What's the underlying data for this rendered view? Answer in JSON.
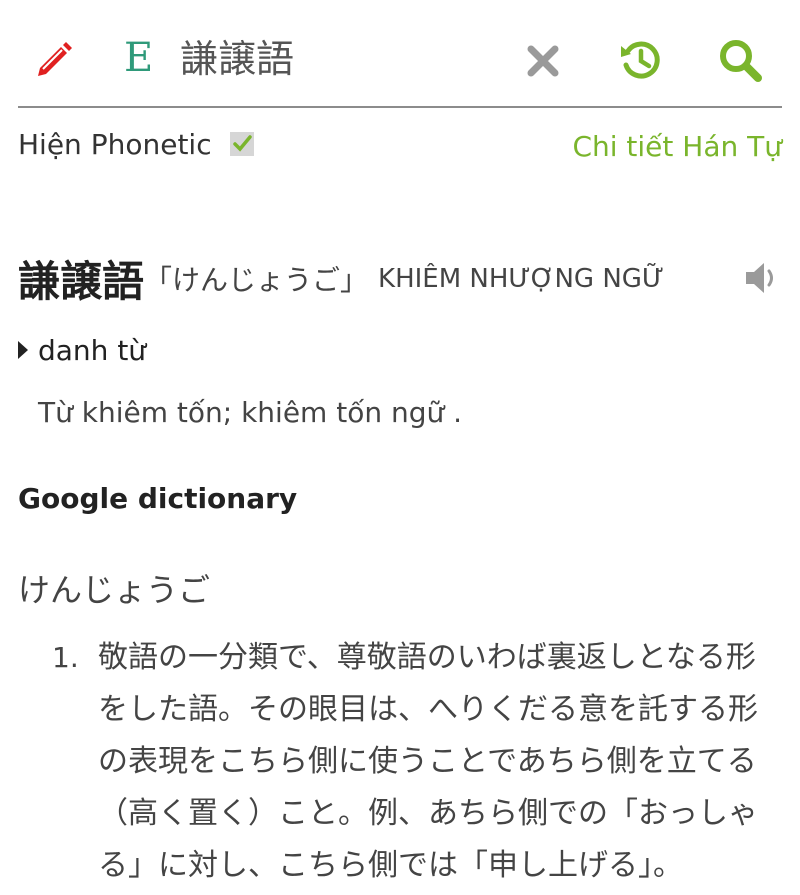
{
  "toolbar": {
    "edit_icon": "pencil-icon",
    "lang_badge": "E",
    "query": "謙譲語",
    "clear_icon": "close-icon",
    "history_icon": "history-icon",
    "search_icon": "search-icon"
  },
  "options": {
    "phonetic_label": "Hiện Phonetic",
    "phonetic_checked": true,
    "kanji_detail_link": "Chi tiết Hán Tự"
  },
  "entry": {
    "headword": "謙譲語",
    "reading": "「けんじょうご」",
    "hanviet": "KHIÊM NHƯỢNG NGỮ",
    "speaker_icon": "speaker-icon",
    "part_of_speech": "danh từ",
    "meaning": "Từ khiêm tốn; khiêm tốn ngữ ."
  },
  "google_dictionary": {
    "title": "Google dictionary",
    "reading": "けんじょうご",
    "definitions": [
      {
        "num": "1.",
        "text": "敬語の一分類で、尊敬語のいわば裏返しとなる形をした語。その眼目は、へりくだる意を託する形の表現をこちら側に使うことであちら側を立てる（高く置く）こと。例、あちら側での「おっしゃる」に対し、こちら側では「申し上げる」。"
      }
    ]
  },
  "colors": {
    "accent_green": "#7ab52c",
    "badge_teal": "#2f9a7a",
    "edit_red": "#e02020",
    "icon_gray": "#9a9a9a"
  }
}
